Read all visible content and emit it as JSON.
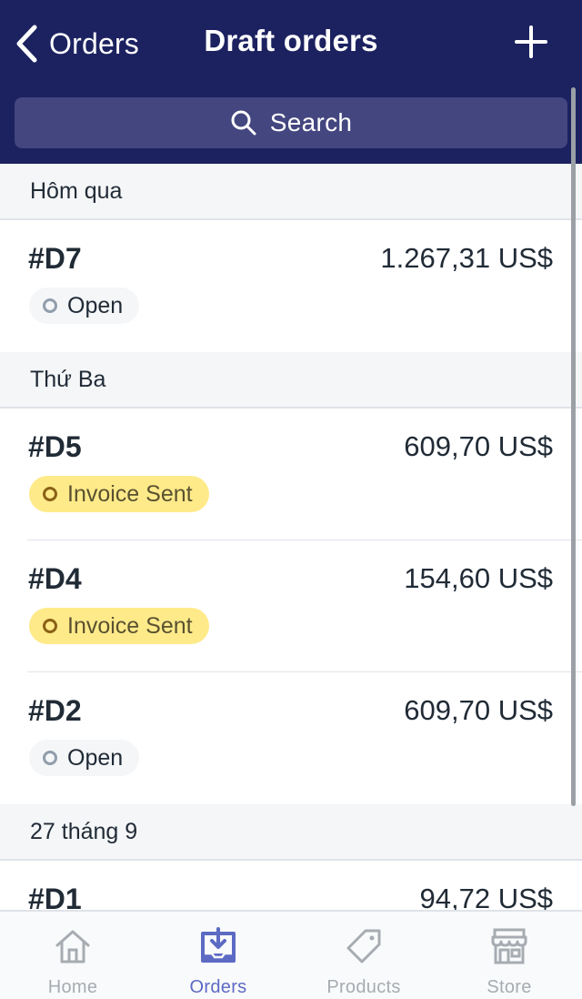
{
  "header": {
    "back_label": "Orders",
    "title": "Draft orders",
    "add_icon": "plus-icon"
  },
  "search": {
    "placeholder": "Search",
    "icon": "search-icon"
  },
  "sections": [
    {
      "label": "Hôm qua",
      "orders": [
        {
          "id": "#D7",
          "total": "1.267,31 US$",
          "status": "Open",
          "status_type": "open"
        }
      ]
    },
    {
      "label": "Thứ Ba",
      "orders": [
        {
          "id": "#D5",
          "total": "609,70 US$",
          "status": "Invoice Sent",
          "status_type": "sent"
        },
        {
          "id": "#D4",
          "total": "154,60 US$",
          "status": "Invoice Sent",
          "status_type": "sent"
        },
        {
          "id": "#D2",
          "total": "609,70 US$",
          "status": "Open",
          "status_type": "open"
        }
      ]
    },
    {
      "label": "27 tháng 9",
      "orders": [
        {
          "id": "#D1",
          "total": "94,72 US$"
        }
      ]
    }
  ],
  "tabs": [
    {
      "label": "Home",
      "icon": "home-icon",
      "active": false
    },
    {
      "label": "Orders",
      "icon": "orders-inbox-icon",
      "active": true
    },
    {
      "label": "Products",
      "icon": "tag-icon",
      "active": false
    },
    {
      "label": "Store",
      "icon": "store-icon",
      "active": false
    }
  ],
  "colors": {
    "header_bg": "#1c2260",
    "search_bg": "#43467f",
    "active_tab": "#5c6ac4",
    "inactive_tab": "#a6acb2",
    "invoice_sent_badge": "#ffea8a",
    "open_badge": "#f4f6f8"
  }
}
